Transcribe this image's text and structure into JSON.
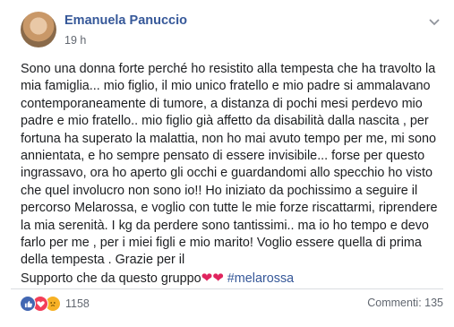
{
  "post": {
    "author": "Emanuela Panuccio",
    "time": "19 h",
    "options_icon": "chevron-down-icon",
    "lines": [
      "Sono una donna forte perché ho resistito alla tempesta che ha travolto la",
      "mia famiglia... mio figlio, il mio unico fratello e mio padre si ammalavano",
      "contemporaneamente di tumore, a distanza di pochi mesi perdevo mio",
      "padre e mio fratello.. mio figlio già affetto da disabilità dalla nascita , per",
      "fortuna ha superato la malattia, non ho mai avuto tempo per me, mi sono",
      "annientata, e ho sempre pensato di essere invisibile... forse per questo",
      "ingrassavo, ora ho aperto gli occhi e guardandomi allo specchio ho visto",
      "che quel involucro non sono io!! Ho iniziato da pochissimo a seguire il",
      "percorso Melarossa, e voglio con tutte le mie forze riscattarmi, riprendere",
      "la mia serenità. I kg da perdere sono tantissimi.. ma io ho tempo e devo",
      "farlo per me , per i miei figli e mio marito! Voglio essere quella di prima",
      "della tempesta . Grazie per il"
    ],
    "last_line_text": "Supporto che da questo gruppo",
    "hearts": "❤❤",
    "hashtag": "#melarossa"
  },
  "footer": {
    "reactions": [
      "like",
      "love",
      "sad"
    ],
    "reaction_count": "1158",
    "comments": "Commenti: 135"
  },
  "colors": {
    "link": "#365899",
    "secondary_text": "#616770",
    "like": "#4267b2",
    "love": "#f33e58",
    "sad": "#f7b125"
  }
}
